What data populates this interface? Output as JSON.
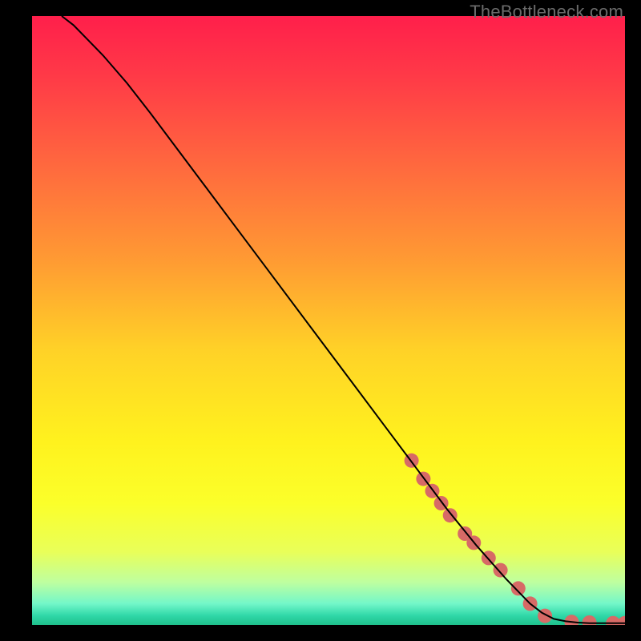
{
  "watermark": "TheBottleneck.com",
  "chart_data": {
    "type": "line",
    "xlim": [
      0,
      100
    ],
    "ylim": [
      0,
      100
    ],
    "title": "",
    "xlabel": "",
    "ylabel": "",
    "background": {
      "type": "vertical-gradient",
      "stops": [
        {
          "offset": 0.0,
          "color": "#ff1f4b"
        },
        {
          "offset": 0.1,
          "color": "#ff3a47"
        },
        {
          "offset": 0.25,
          "color": "#ff6a3e"
        },
        {
          "offset": 0.4,
          "color": "#ff9a33"
        },
        {
          "offset": 0.55,
          "color": "#ffd227"
        },
        {
          "offset": 0.7,
          "color": "#fff21e"
        },
        {
          "offset": 0.8,
          "color": "#fbff2a"
        },
        {
          "offset": 0.88,
          "color": "#e9ff59"
        },
        {
          "offset": 0.93,
          "color": "#beffa0"
        },
        {
          "offset": 0.965,
          "color": "#73f7c9"
        },
        {
          "offset": 0.985,
          "color": "#2fd7a7"
        },
        {
          "offset": 1.0,
          "color": "#1fc08b"
        }
      ]
    },
    "series": [
      {
        "name": "curve",
        "color": "#000000",
        "stroke_width": 2,
        "x": [
          5,
          7,
          9,
          12,
          16,
          20,
          25,
          30,
          35,
          40,
          45,
          50,
          55,
          60,
          65,
          70,
          75,
          80,
          84,
          86,
          88,
          90,
          92,
          94,
          96,
          98,
          100
        ],
        "y": [
          100,
          98.5,
          96.5,
          93.5,
          89,
          84,
          77.5,
          71,
          64.5,
          58,
          51.5,
          45,
          38.5,
          32,
          25.5,
          19,
          13,
          7.5,
          3.5,
          2,
          1,
          0.6,
          0.4,
          0.3,
          0.3,
          0.3,
          0.3
        ]
      }
    ],
    "markers": {
      "color": "#d76a66",
      "radius": 9,
      "points": [
        {
          "x": 64,
          "y": 27
        },
        {
          "x": 66,
          "y": 24
        },
        {
          "x": 67.5,
          "y": 22
        },
        {
          "x": 69,
          "y": 20
        },
        {
          "x": 70.5,
          "y": 18
        },
        {
          "x": 73,
          "y": 15
        },
        {
          "x": 74.5,
          "y": 13.5
        },
        {
          "x": 77,
          "y": 11
        },
        {
          "x": 79,
          "y": 9
        },
        {
          "x": 82,
          "y": 6
        },
        {
          "x": 84,
          "y": 3.5
        },
        {
          "x": 86.5,
          "y": 1.5
        },
        {
          "x": 91,
          "y": 0.5
        },
        {
          "x": 94,
          "y": 0.4
        },
        {
          "x": 98,
          "y": 0.3
        },
        {
          "x": 100,
          "y": 0.3
        }
      ]
    }
  }
}
